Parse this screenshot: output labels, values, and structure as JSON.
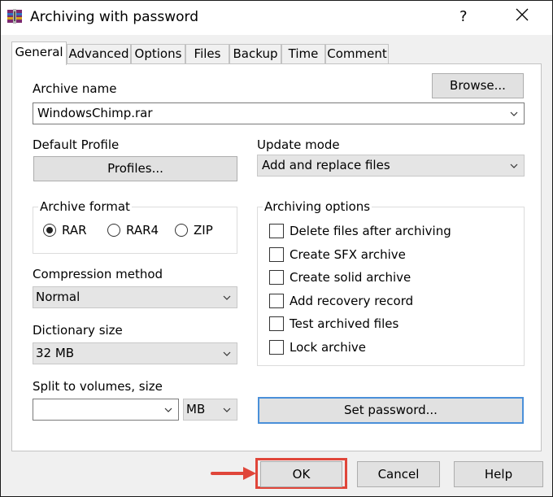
{
  "window": {
    "title": "Archiving with password",
    "help_label": "?",
    "icon": "winrar-icon"
  },
  "tabs": [
    {
      "label": "General",
      "active": true
    },
    {
      "label": "Advanced"
    },
    {
      "label": "Options"
    },
    {
      "label": "Files"
    },
    {
      "label": "Backup"
    },
    {
      "label": "Time"
    },
    {
      "label": "Comment"
    }
  ],
  "general": {
    "archive_name_label": "Archive name",
    "browse_label": "Browse...",
    "archive_name_value": "WindowsChimp.rar",
    "default_profile_label": "Default Profile",
    "profiles_label": "Profiles...",
    "update_mode_label": "Update mode",
    "update_mode_value": "Add and replace files",
    "archive_format_label": "Archive format",
    "formats": [
      {
        "label": "RAR",
        "selected": true
      },
      {
        "label": "RAR4",
        "selected": false
      },
      {
        "label": "ZIP",
        "selected": false
      }
    ],
    "compression_method_label": "Compression method",
    "compression_method_value": "Normal",
    "dictionary_size_label": "Dictionary size",
    "dictionary_size_value": "32 MB",
    "split_label": "Split to volumes, size",
    "split_value": "",
    "split_unit": "MB",
    "archiving_options_label": "Archiving options",
    "options": [
      {
        "label": "Delete files after archiving",
        "checked": false
      },
      {
        "label": "Create SFX archive",
        "checked": false
      },
      {
        "label": "Create solid archive",
        "checked": false
      },
      {
        "label": "Add recovery record",
        "checked": false
      },
      {
        "label": "Test archived files",
        "checked": false
      },
      {
        "label": "Lock archive",
        "checked": false
      }
    ],
    "set_password_label": "Set password..."
  },
  "footer": {
    "ok_label": "OK",
    "cancel_label": "Cancel",
    "help_label": "Help",
    "highlight_color": "#e0463a"
  }
}
